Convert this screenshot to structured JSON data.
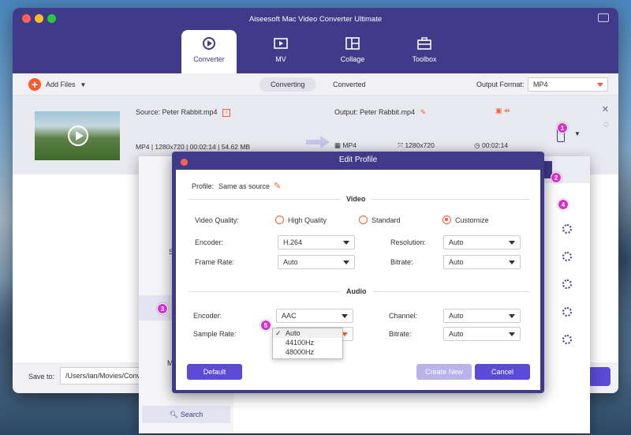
{
  "app": {
    "title": "Aiseesoft Mac Video Converter Ultimate",
    "tabs": [
      {
        "label": "Converter",
        "icon": "converter-icon"
      },
      {
        "label": "MV",
        "icon": "mv-icon"
      },
      {
        "label": "Collage",
        "icon": "collage-icon"
      },
      {
        "label": "Toolbox",
        "icon": "toolbox-icon"
      }
    ]
  },
  "toolbar": {
    "add_files": "Add Files",
    "segments": [
      "Converting",
      "Converted"
    ],
    "output_format_label": "Output Format:",
    "output_format_value": "MP4"
  },
  "file": {
    "source": "Source: Peter Rabbit.mp4",
    "meta": "MP4  |  1280x720  |  00:02:14  |  54.62 MB",
    "output": "Output: Peter Rabbit.mp4",
    "out_format": "MP4",
    "out_resolution": "1280x720",
    "out_duration": "00:02:14"
  },
  "bottom": {
    "save_to_label": "Save to:",
    "save_path": "/Users/ian/Movies/Conve"
  },
  "profile_list": {
    "items": [
      "A",
      "SA",
      "H",
      "",
      "X",
      "MC"
    ],
    "search_label": "Search"
  },
  "dialog": {
    "title": "Edit Profile",
    "profile_label": "Profile:",
    "profile_value": "Same as source",
    "video_section": "Video",
    "video_quality_label": "Video Quality:",
    "quality_options": [
      "High Quality",
      "Standard",
      "Customize"
    ],
    "encoder_label": "Encoder:",
    "encoder_value": "H.264",
    "resolution_label": "Resolution:",
    "resolution_value": "Auto",
    "frame_rate_label": "Frame Rate:",
    "frame_rate_value": "Auto",
    "bitrate_label": "Bitrate:",
    "video_bitrate_value": "Auto",
    "audio_section": "Audio",
    "audio_encoder_label": "Encoder:",
    "audio_encoder_value": "AAC",
    "channel_label": "Channel:",
    "channel_value": "Auto",
    "sample_rate_label": "Sample Rate:",
    "audio_bitrate_label": "Bitrate:",
    "audio_bitrate_value": "Auto",
    "sample_rate_options": [
      "Auto",
      "44100Hz",
      "48000Hz"
    ],
    "check_mark": "✓",
    "buttons": {
      "default": "Default",
      "create": "Create New",
      "cancel": "Cancel"
    }
  },
  "markers": [
    "1",
    "2",
    "3",
    "4",
    "5"
  ],
  "colors": {
    "accent": "#ff5a2d",
    "brand": "#3f3a8a",
    "button": "#5b4bd6",
    "marker": "#d62fd1"
  }
}
